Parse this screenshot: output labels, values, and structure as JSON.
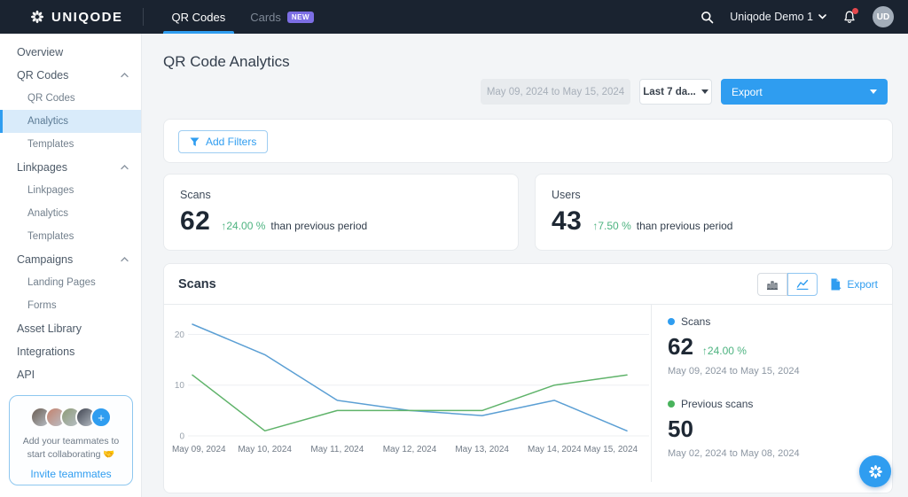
{
  "topbar": {
    "brand": "UNIQODE",
    "tab_qr": "QR Codes",
    "tab_cards": "Cards",
    "new_badge": "NEW",
    "account_name": "Uniqode Demo 1",
    "avatar_initials": "UD"
  },
  "sidebar": {
    "items": [
      {
        "label": "Overview",
        "level": 0
      },
      {
        "label": "QR Codes",
        "level": 0,
        "chevron": true
      },
      {
        "label": "QR Codes",
        "level": 1
      },
      {
        "label": "Analytics",
        "level": 1,
        "active": true
      },
      {
        "label": "Templates",
        "level": 1
      },
      {
        "label": "Linkpages",
        "level": 0,
        "chevron": true
      },
      {
        "label": "Linkpages",
        "level": 1
      },
      {
        "label": "Analytics",
        "level": 1
      },
      {
        "label": "Templates",
        "level": 1
      },
      {
        "label": "Campaigns",
        "level": 0,
        "chevron": true
      },
      {
        "label": "Landing Pages",
        "level": 1
      },
      {
        "label": "Forms",
        "level": 1
      },
      {
        "label": "Asset Library",
        "level": 0
      },
      {
        "label": "Integrations",
        "level": 0
      },
      {
        "label": "API",
        "level": 0
      }
    ],
    "invite": {
      "line1": "Add your teammates to",
      "line2": "start collaborating 🤝",
      "link_label": "Invite teammates",
      "avatar_colors": [
        "#6b5d52",
        "#c4826d",
        "#8d9b77",
        "#3f4450"
      ]
    }
  },
  "page": {
    "title": "QR Code Analytics"
  },
  "controls": {
    "date_range": "May 09, 2024 to May 15, 2024",
    "range_preset": "Last 7 da...",
    "export_label": "Export"
  },
  "filters": {
    "add_label": "Add Filters"
  },
  "stats": {
    "scans": {
      "label": "Scans",
      "value": "62",
      "delta": "↑24.00 %",
      "suffix": "than previous period"
    },
    "users": {
      "label": "Users",
      "value": "43",
      "delta": "↑7.50 %",
      "suffix": "than previous period"
    }
  },
  "scans_panel": {
    "title": "Scans",
    "export_label": "Export",
    "legend": {
      "current": {
        "label": "Scans",
        "value": "62",
        "delta": "↑24.00 %",
        "period": "May 09, 2024 to May 15, 2024",
        "dot_color": "#2f9df0"
      },
      "previous": {
        "label": "Previous scans",
        "value": "50",
        "period": "May 02, 2024 to May 08, 2024",
        "dot_color": "#49b35c"
      }
    }
  },
  "chart_data": {
    "type": "line",
    "title": "Scans",
    "x": [
      "May 09, 2024",
      "May 10, 2024",
      "May 11, 2024",
      "May 12, 2024",
      "May 13, 2024",
      "May 14, 2024",
      "May 15, 2024"
    ],
    "series": [
      {
        "name": "Scans",
        "color": "#5b9fd4",
        "values": [
          22,
          16,
          7,
          5,
          4,
          7,
          1
        ]
      },
      {
        "name": "Previous scans",
        "color": "#5fb36a",
        "values": [
          12,
          1,
          5,
          5,
          5,
          10,
          12
        ]
      }
    ],
    "yticks": [
      0,
      10,
      20
    ],
    "ylim": [
      0,
      22
    ],
    "grid": true,
    "legend_position": "right"
  },
  "colors": {
    "accent_blue": "#2f9df0",
    "positive_green": "#4db380",
    "navbar_bg": "#1a2330",
    "badge_purple": "#7c6ee4"
  }
}
